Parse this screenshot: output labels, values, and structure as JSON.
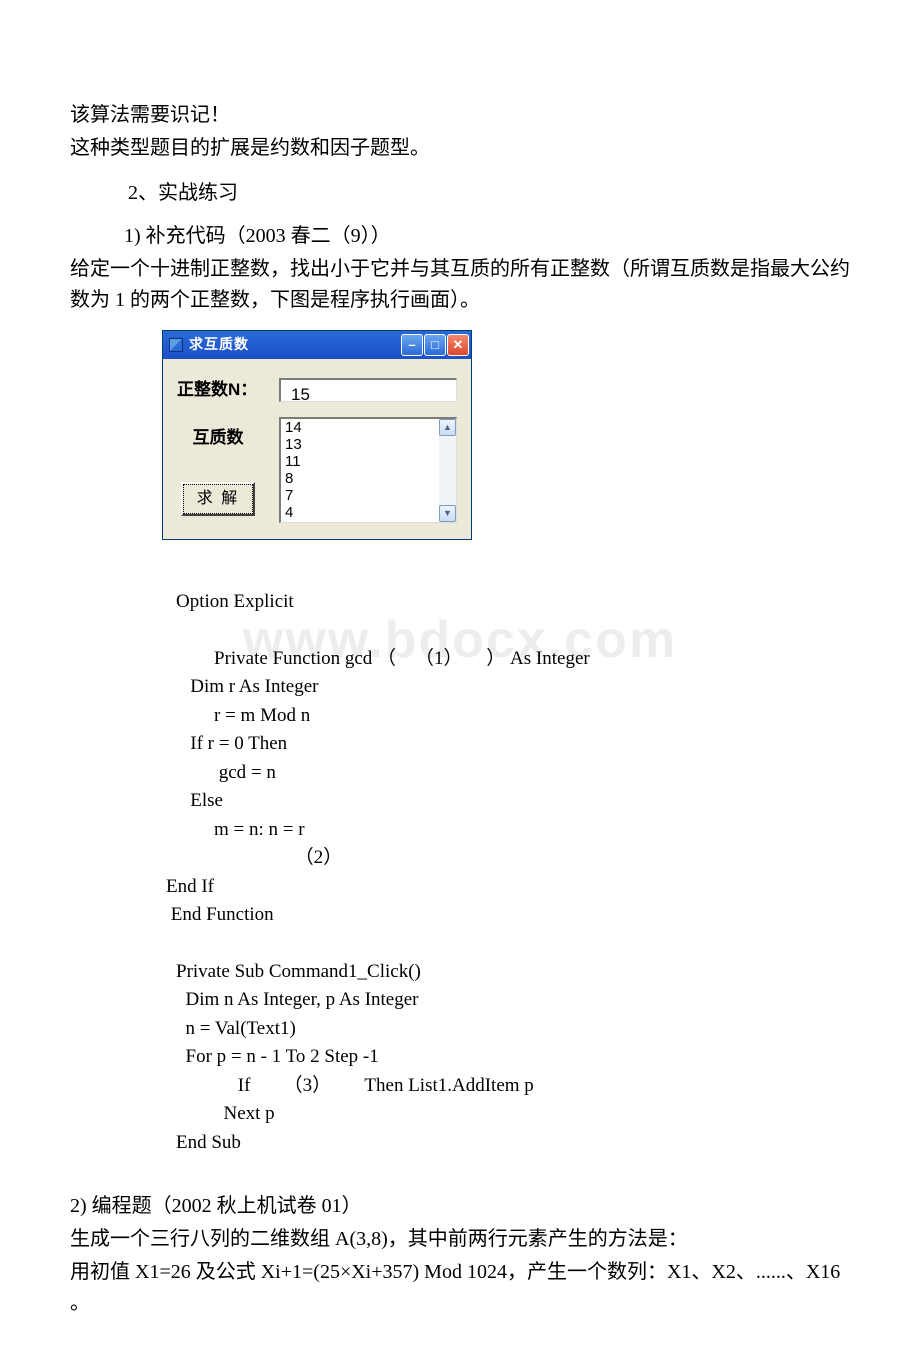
{
  "intro": {
    "line1": "该算法需要识记！",
    "line2": "这种类型题目的扩展是约数和因子题型。"
  },
  "section2": {
    "heading": "2、实战练习",
    "item1_label": "1)       补充代码（2003 春二（9））",
    "item1_body_l1": " 给定一个十进制正整数，找出小于它并与其互质的所有正整数（所谓互质数是指最大公约数为 1 的两个正整数，下图是程序执行画面）。"
  },
  "vbwin": {
    "title": "求互质数",
    "label_n": "正整数N：",
    "input_value": "15",
    "label_list": "互质数",
    "button": "求  解",
    "list_items": [
      "14",
      "13",
      "11",
      "8",
      "7",
      "4"
    ]
  },
  "code": {
    "l0": "Option Explicit",
    "l1": "        Private Function gcd （    （1）     ） As Integer",
    "l2": "   Dim r As Integer",
    "l3": "        r = m Mod n",
    "l4": "   If r = 0 Then",
    "l5": "         gcd = n",
    "l6": "   Else",
    "l7": "        m = n: n = r",
    "l8": "                         （2）",
    "l9": "End If",
    "l10": " End Function",
    "l11": "Private Sub Command1_Click()",
    "l12": "  Dim n As Integer, p As Integer",
    "l13": "  n = Val(Text1)",
    "l14": "  For p = n - 1 To 2 Step -1",
    "l15": "             If       （3）       Then List1.AddItem p",
    "l16": "          Next p",
    "l17": "End Sub"
  },
  "q2": {
    "label": "2)       编程题（2002 秋上机试卷 01）",
    "l1": "        生成一个三行八列的二维数组 A(3,8)，其中前两行元素产生的方法是：",
    "l2": "用初值 X1=26 及公式 Xi+1=(25×Xi+357) Mod 1024，产生一个数列：X1、X2、......、X16 。"
  },
  "watermark": "www.bdocx.com"
}
